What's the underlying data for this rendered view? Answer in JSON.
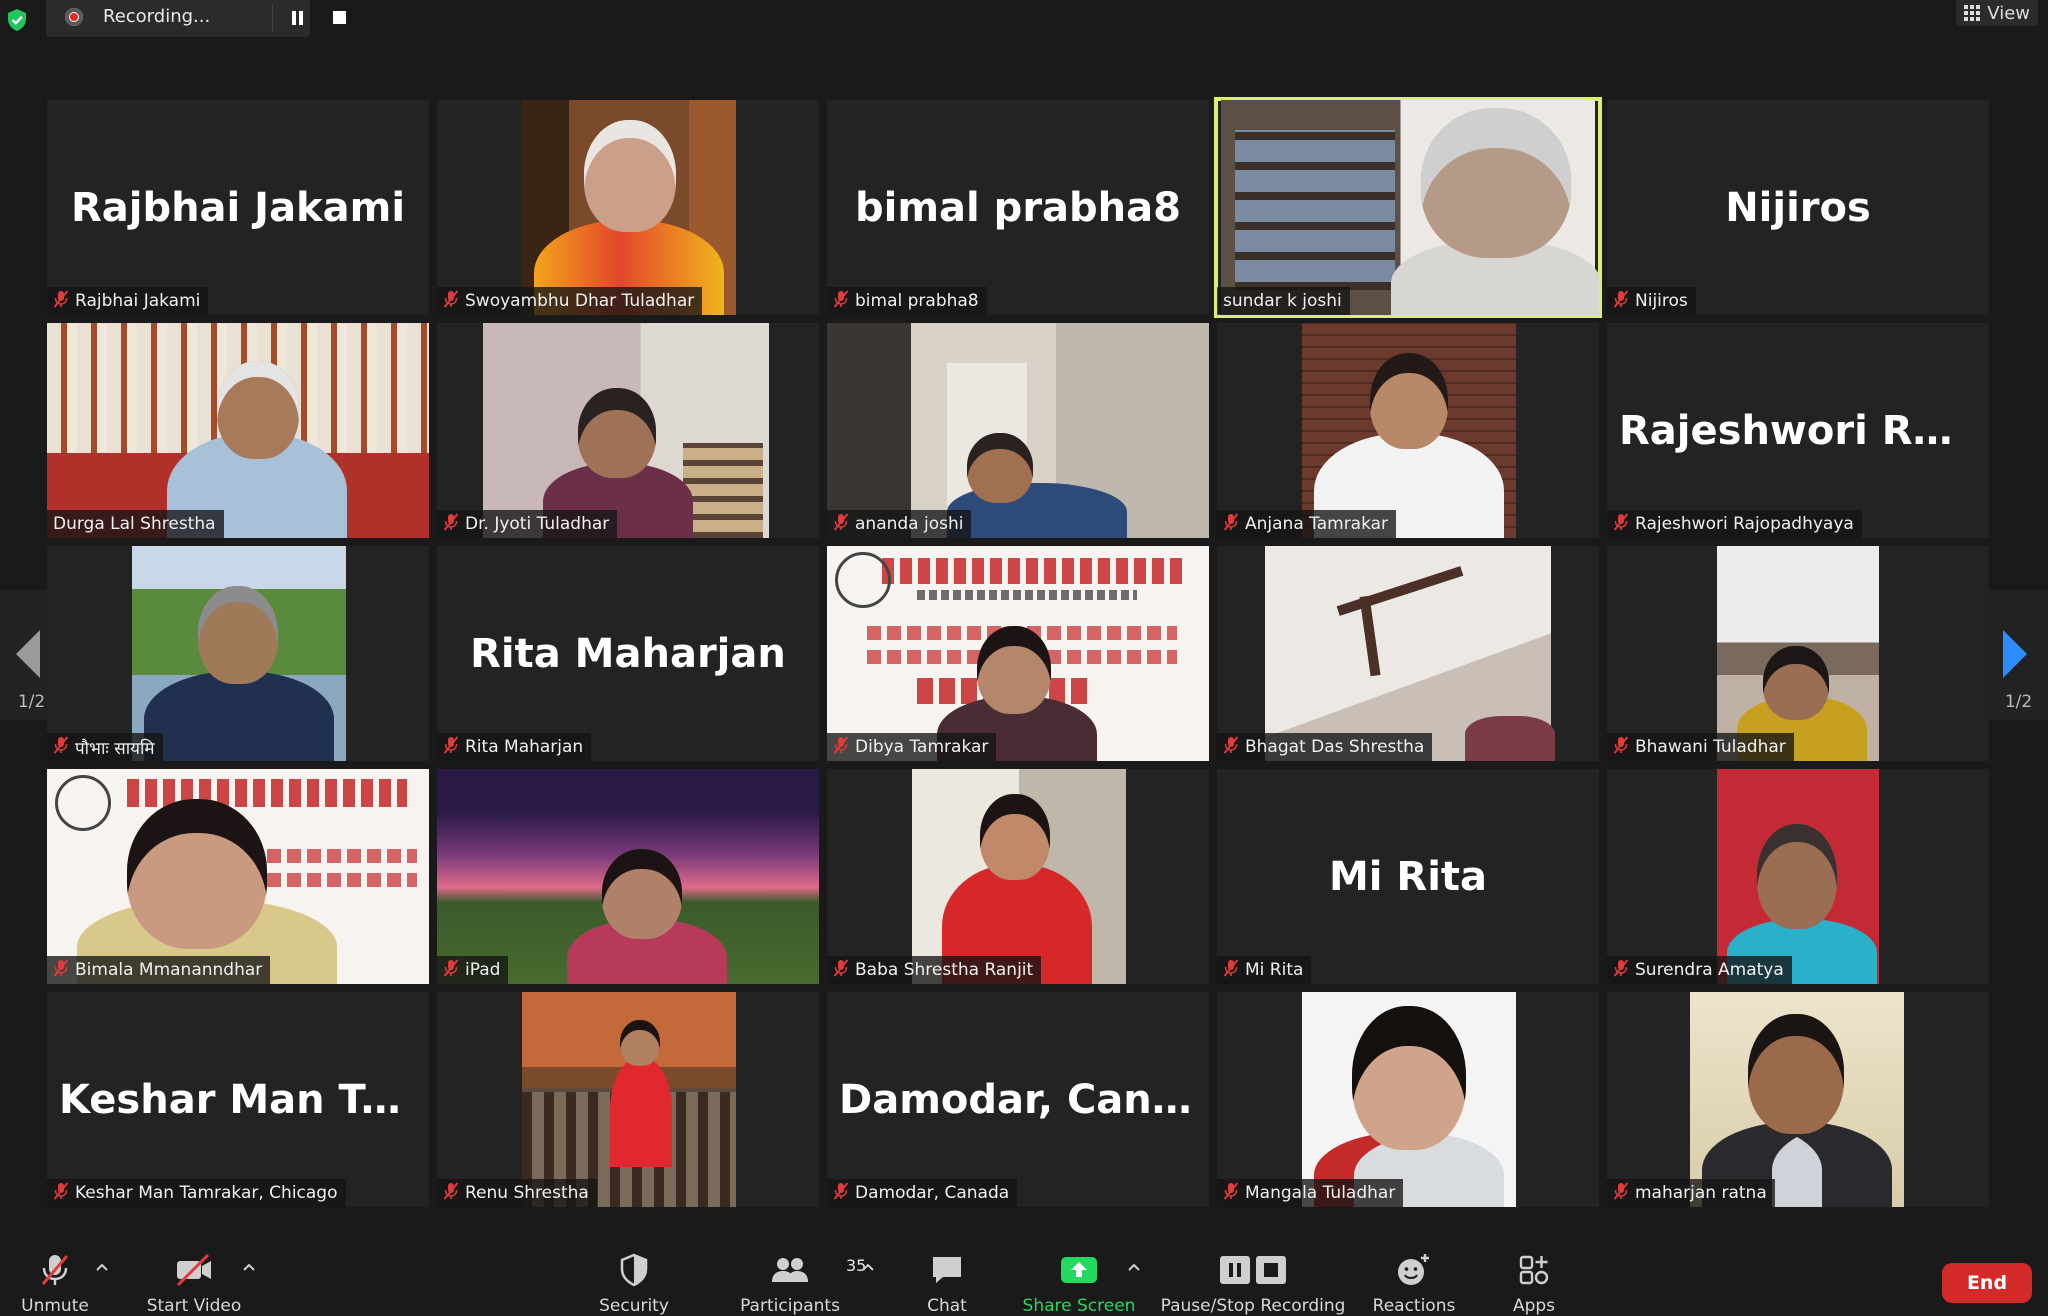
{
  "recording": {
    "label": "Recording..."
  },
  "view": {
    "label": "View"
  },
  "pagination": {
    "left": "1/2",
    "right": "1/2"
  },
  "tiles": [
    {
      "display": "Rajbhai Jakami",
      "label": "Rajbhai Jakami",
      "muted": true
    },
    {
      "display": "",
      "label": "Swoyambhu Dhar Tuladhar",
      "muted": true
    },
    {
      "display": "bimal prabha8",
      "label": "bimal prabha8",
      "muted": true
    },
    {
      "display": "",
      "label": "sundar k joshi",
      "muted": false
    },
    {
      "display": "Nijiros",
      "label": "Nijiros",
      "muted": true
    },
    {
      "display": "",
      "label": "Durga Lal Shrestha",
      "muted": false
    },
    {
      "display": "",
      "label": "Dr. Jyoti Tuladhar",
      "muted": true
    },
    {
      "display": "",
      "label": "ananda joshi",
      "muted": true
    },
    {
      "display": "",
      "label": "Anjana Tamrakar",
      "muted": true
    },
    {
      "display": "Rajeshwori  Rajo...",
      "label": "Rajeshwori Rajopadhyaya",
      "muted": true
    },
    {
      "display": "",
      "label": "पौभाः सायमि",
      "muted": true
    },
    {
      "display": "Rita Maharjan",
      "label": "Rita Maharjan",
      "muted": true
    },
    {
      "display": "",
      "label": "Dibya Tamrakar",
      "muted": true
    },
    {
      "display": "",
      "label": "Bhagat Das Shrestha",
      "muted": true
    },
    {
      "display": "",
      "label": "Bhawani Tuladhar",
      "muted": true
    },
    {
      "display": "",
      "label": "Bimala Mmananndhar",
      "muted": true
    },
    {
      "display": "",
      "label": "iPad",
      "muted": true
    },
    {
      "display": "",
      "label": "Baba Shrestha Ranjit",
      "muted": true
    },
    {
      "display": "Mi Rita",
      "label": "Mi Rita",
      "muted": true
    },
    {
      "display": "",
      "label": "Surendra Amatya",
      "muted": true
    },
    {
      "display": "Keshar  Man  Tam...",
      "label": "Keshar Man Tamrakar, Chicago",
      "muted": true
    },
    {
      "display": "",
      "label": "Renu Shrestha",
      "muted": true
    },
    {
      "display": "Damodar, Canada",
      "label": "Damodar, Canada",
      "muted": true
    },
    {
      "display": "",
      "label": "Mangala Tuladhar",
      "muted": true
    },
    {
      "display": "",
      "label": "maharjan ratna",
      "muted": true
    }
  ],
  "toolbar": {
    "unmute": "Unmute",
    "start_video": "Start Video",
    "security": "Security",
    "participants": "Participants",
    "participants_count": "35",
    "chat": "Chat",
    "share_screen": "Share Screen",
    "pause_stop": "Pause/Stop Recording",
    "reactions": "Reactions",
    "apps": "Apps",
    "end": "End"
  },
  "colors": {
    "active_speaker": "#d9f26a",
    "share_green": "#23d95f",
    "end_red": "#d52a2a",
    "muted_red": "#e23b3b",
    "shield_green": "#22c55e"
  }
}
